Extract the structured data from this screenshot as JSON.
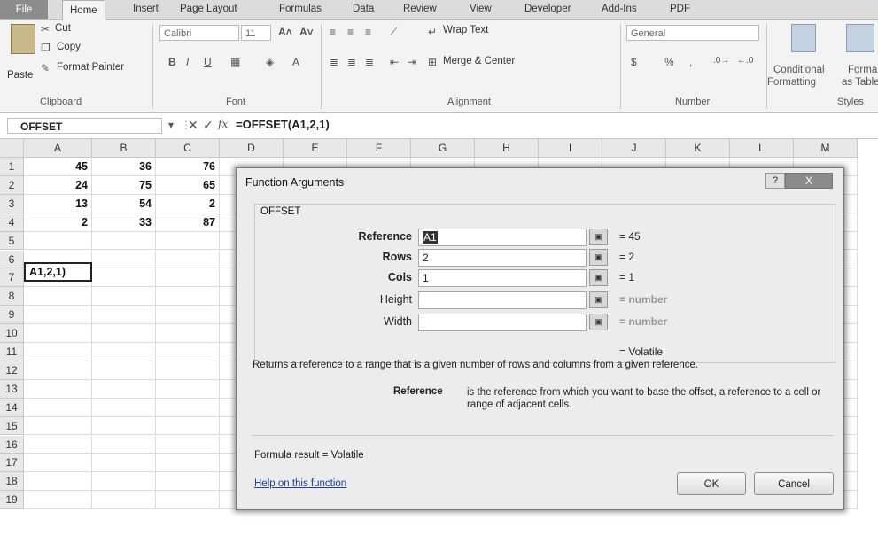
{
  "ribbon_tabs": [
    "File",
    "Home",
    "Insert",
    "Page Layout",
    "Formulas",
    "Data",
    "Review",
    "View",
    "Developer",
    "Add-Ins",
    "PDF"
  ],
  "clipboard": {
    "paste": "Paste",
    "cut": "Cut",
    "copy": "Copy",
    "format_painter": "Format Painter",
    "label": "Clipboard"
  },
  "font": {
    "name": "Calibri",
    "size": "11",
    "label": "Font"
  },
  "alignment": {
    "wrap_text": "Wrap Text",
    "merge_center": "Merge & Center",
    "label": "Alignment"
  },
  "number": {
    "format": "General",
    "label": "Number"
  },
  "styles": {
    "conditional_line1": "Conditional",
    "conditional_line2": "Formatting",
    "format_as_line1": "Forma",
    "format_as_line2": "as Table",
    "label": "Styles"
  },
  "formula_bar": {
    "name_box": "OFFSET",
    "formula": "=OFFSET(A1,2,1)",
    "fx": "fx"
  },
  "columns": [
    "A",
    "B",
    "C",
    "D",
    "E",
    "F",
    "G",
    "H",
    "I",
    "J",
    "K",
    "L",
    "M"
  ],
  "rows": [
    "1",
    "2",
    "3",
    "4",
    "5",
    "6",
    "7",
    "8",
    "9",
    "10",
    "11",
    "12",
    "13",
    "14",
    "15",
    "16",
    "17",
    "18",
    "19"
  ],
  "cells": [
    [
      "45",
      "36",
      "76"
    ],
    [
      "24",
      "75",
      "65"
    ],
    [
      "13",
      "54",
      "2"
    ],
    [
      "2",
      "33",
      "87"
    ]
  ],
  "active_cell_text": "A1,2,1)",
  "dialog": {
    "title": "Function Arguments",
    "help": "?",
    "close": "X",
    "function_name": "OFFSET",
    "args": [
      {
        "label": "Reference",
        "value": "A1",
        "result": "= 45"
      },
      {
        "label": "Rows",
        "value": "2",
        "result": "= 2"
      },
      {
        "label": "Cols",
        "value": "1",
        "result": "= 1"
      },
      {
        "label": "Height",
        "value": "",
        "result": "= number"
      },
      {
        "label": "Width",
        "value": "",
        "result": "= number"
      }
    ],
    "overall_result": "= Volatile",
    "description": "Returns a reference to a range that is a given number of rows and columns from a given reference.",
    "arg_help_label": "Reference",
    "arg_help_text": "is the reference from which you want to base the offset, a reference to a cell or range of adjacent cells.",
    "formula_result": "Formula result =  Volatile",
    "help_link": "Help on this function",
    "ok": "OK",
    "cancel": "Cancel"
  }
}
